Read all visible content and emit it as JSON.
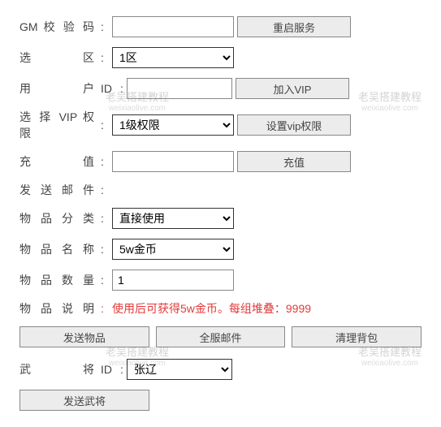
{
  "labels": {
    "gm_code": "GM 校 验 码",
    "zone": "选　　　区",
    "user": "用　　　户",
    "user_suffix": "ID",
    "vip_perm": "选 择 VIP 权 限",
    "recharge": "充　　　值",
    "send_mail": "发 送 邮 件",
    "item_cat": "物 品 分 类",
    "item_name": "物 品 名 称",
    "item_qty": "物 品 数 量",
    "item_desc": "物 品 说 明",
    "general": "武　　　将",
    "general_suffix": "ID"
  },
  "inputs": {
    "gm_code": "",
    "user_id": "",
    "recharge": "",
    "item_qty": "1"
  },
  "selects": {
    "zone": "1区",
    "vip_perm": "1级权限",
    "item_cat": "直接使用",
    "item_name": "5w金币",
    "general": "张辽"
  },
  "buttons": {
    "restart": "重启服务",
    "join_vip": "加入VIP",
    "set_vip": "设置vip权限",
    "recharge": "充值",
    "send_item": "发送物品",
    "server_mail": "全服邮件",
    "clear_bag": "清理背包",
    "send_general": "发送武将"
  },
  "item_desc_text": "使用后可获得5w金币。每组堆叠：9999",
  "watermark": {
    "title": "老吴搭建教程",
    "sub": "weixiaolive.com"
  }
}
